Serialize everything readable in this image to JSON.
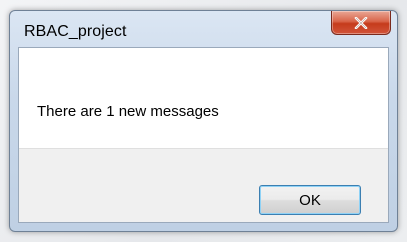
{
  "window": {
    "title": "RBAC_project"
  },
  "dialog": {
    "message": "There are 1 new messages",
    "ok_label": "OK"
  },
  "icons": {
    "close": "close-icon"
  },
  "colors": {
    "close_button": "#c53b1c",
    "ok_button_border": "#3c7fb1",
    "footer_background": "#f0f0f0"
  }
}
